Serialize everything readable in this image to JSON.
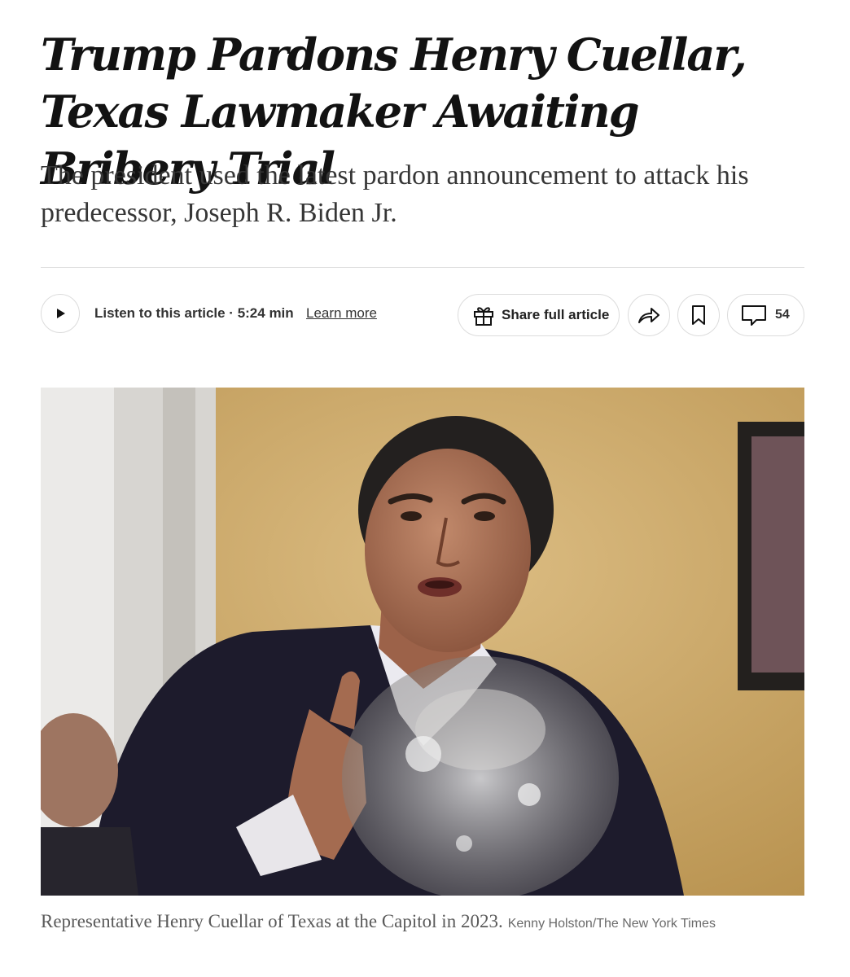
{
  "article": {
    "headline": "Trump Pardons Henry Cuellar, Texas Lawmaker Awaiting Bribery Trial",
    "summary": "The president used the latest pardon announcement to attack his predecessor, Joseph R. Biden Jr."
  },
  "toolbar": {
    "listen_label": "Listen to this article · 5:24 min",
    "learn_more": "Learn more",
    "share_full_label": "Share full article",
    "comment_count": "54",
    "icons": [
      "play-icon",
      "gift-icon",
      "share-arrow-icon",
      "bookmark-icon",
      "comment-icon"
    ]
  },
  "photo": {
    "caption": "Representative Henry Cuellar of Texas at the Capitol in 2023.",
    "credit": "Kenny Holston/The New York Times"
  },
  "colors": {
    "text": "#121212",
    "summary_text": "#363636",
    "border": "#dcdcdc",
    "caption_text": "#5a5a5a"
  }
}
